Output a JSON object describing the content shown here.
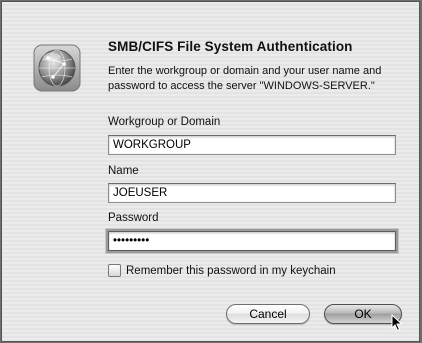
{
  "dialog": {
    "title": "SMB/CIFS File System Authentication",
    "message": "Enter the workgroup or domain and your user name and password to access the server \"WINDOWS-SERVER.\"",
    "icon": "network-globe-icon"
  },
  "fields": {
    "workgroup_label": "Workgroup or Domain",
    "workgroup_value": "WORKGROUP",
    "name_label": "Name",
    "name_value": "JOEUSER",
    "password_label": "Password",
    "password_value": "•••••••••"
  },
  "keychain": {
    "label": "Remember this password in my keychain",
    "checked": false
  },
  "buttons": {
    "cancel_label": "Cancel",
    "ok_label": "OK"
  }
}
